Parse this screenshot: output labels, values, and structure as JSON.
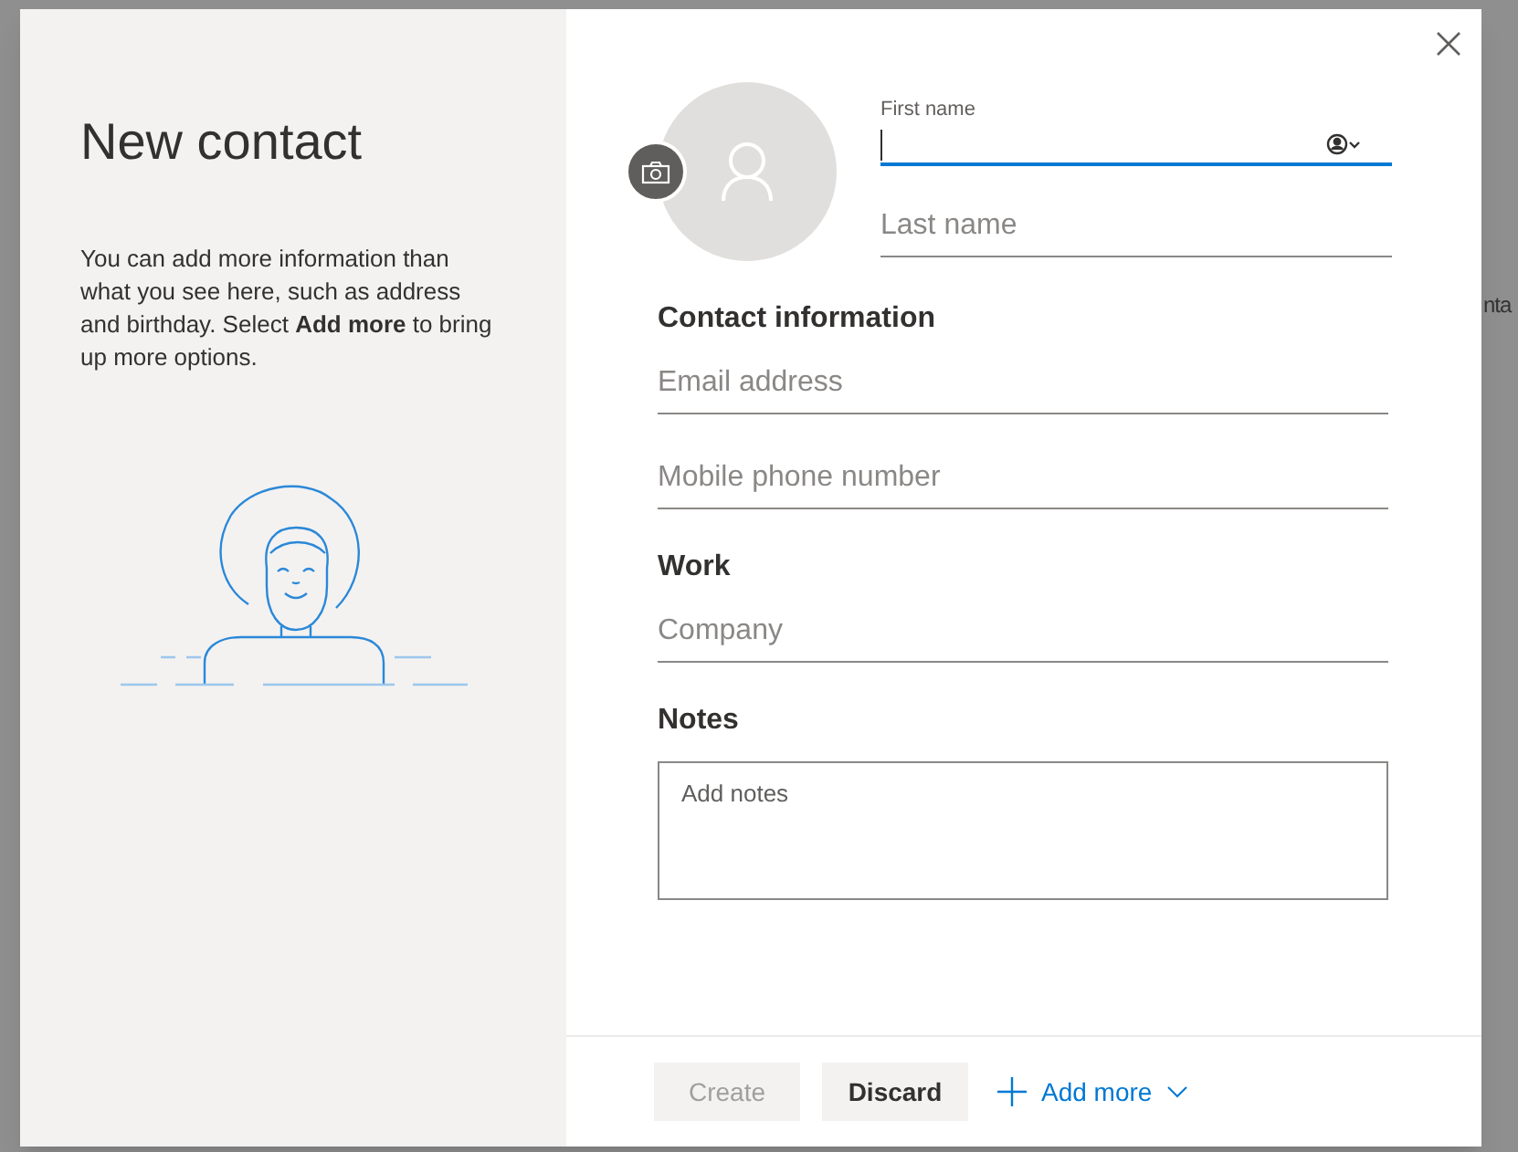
{
  "background": {
    "fragment": "nta"
  },
  "dialog": {
    "title": "New contact",
    "intro": "You can add more information than what you see here, such as address and birthday. Select **Add more** to bring up more options.",
    "first_name": {
      "label": "First name",
      "focused": true
    },
    "last_name": {
      "placeholder": "Last name"
    },
    "sections": [
      {
        "heading": "Contact information",
        "fields": [
          {
            "placeholder": "Email address"
          },
          {
            "placeholder": "Mobile phone number"
          }
        ]
      },
      {
        "heading": "Work",
        "fields": [
          {
            "placeholder": "Company"
          }
        ]
      }
    ],
    "notes": {
      "heading": "Notes",
      "placeholder": "Add notes"
    },
    "buttons": [
      {
        "label": "Create",
        "disabled": true
      },
      {
        "label": "Discard",
        "disabled": false
      }
    ],
    "add_more": "Add more"
  }
}
